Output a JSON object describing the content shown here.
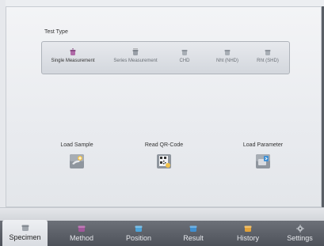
{
  "test_type": {
    "title": "Test Type",
    "options": [
      {
        "label": "Single Measurement",
        "selected": true
      },
      {
        "label": "Series Measurement",
        "selected": false
      },
      {
        "label": "CHD",
        "selected": false
      },
      {
        "label": "Nht (NHD)",
        "selected": false
      },
      {
        "label": "Rht (SHD)",
        "selected": false
      }
    ]
  },
  "actions": {
    "load_sample": "Load Sample",
    "read_qr": "Read QR-Code",
    "load_parameter": "Load Parameter"
  },
  "tabs": [
    {
      "label": "Specimen",
      "active": true
    },
    {
      "label": "Method",
      "active": false
    },
    {
      "label": "Position",
      "active": false
    },
    {
      "label": "Result",
      "active": false
    },
    {
      "label": "History",
      "active": false
    },
    {
      "label": "Settings",
      "active": false
    }
  ],
  "colors": {
    "accent_purple": "#a0579a",
    "tab_bar": "#5a5f66",
    "position_blue": "#4da3d9",
    "result_blue": "#3f8fd0",
    "history_orange": "#e2a23a"
  }
}
